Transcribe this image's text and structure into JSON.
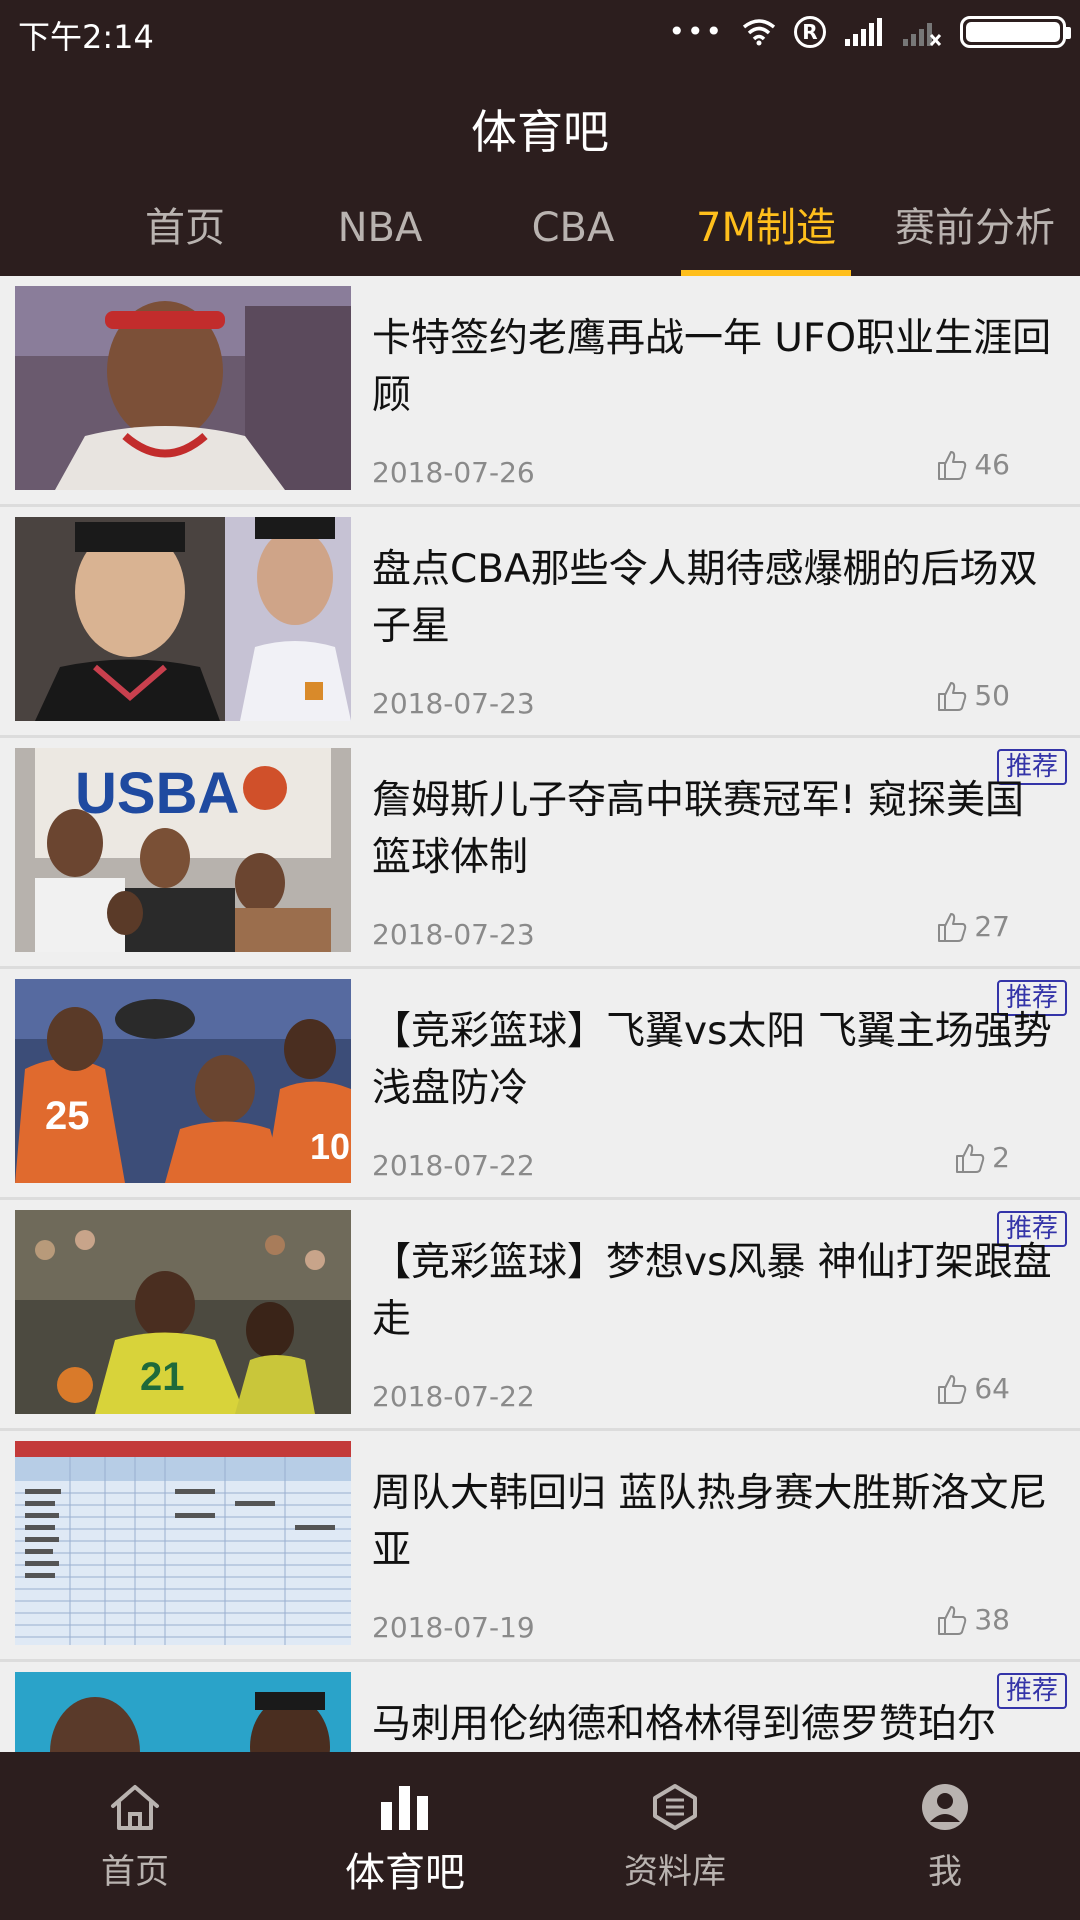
{
  "status_bar": {
    "time": "下午2:14",
    "dots": "•••"
  },
  "header": {
    "title": "体育吧"
  },
  "tabs": [
    {
      "label": "首页"
    },
    {
      "label": "NBA"
    },
    {
      "label": "CBA"
    },
    {
      "label": "7M制造"
    },
    {
      "label": "赛前分析"
    }
  ],
  "active_tab_index": 3,
  "articles": [
    {
      "title": "卡特签约老鹰再战一年 UFO职业生涯回顾",
      "date": "2018-07-26",
      "likes": "46",
      "badge": ""
    },
    {
      "title": "盘点CBA那些令人期待感爆棚的后场双子星",
      "date": "2018-07-23",
      "likes": "50",
      "badge": ""
    },
    {
      "title": "詹姆斯儿子夺高中联赛冠军! 窥探美国篮球体制",
      "date": "2018-07-23",
      "likes": "27",
      "badge": "推荐"
    },
    {
      "title": "【竞彩篮球】飞翼vs太阳 飞翼主场强势浅盘防冷",
      "date": "2018-07-22",
      "likes": "2",
      "badge": "推荐"
    },
    {
      "title": "【竞彩篮球】梦想vs风暴 神仙打架跟盘走",
      "date": "2018-07-22",
      "likes": "64",
      "badge": "推荐"
    },
    {
      "title": "周队大韩回归 蓝队热身赛大胜斯洛文尼亚",
      "date": "2018-07-19",
      "likes": "38",
      "badge": ""
    },
    {
      "title": "马刺用伦纳德和格林得到德罗赞珀尔",
      "date": "",
      "likes": "",
      "badge": "推荐"
    }
  ],
  "bottom_nav": [
    {
      "label": "首页",
      "icon": "home-icon"
    },
    {
      "label": "体育吧",
      "icon": "bar-chart-icon"
    },
    {
      "label": "资料库",
      "icon": "database-icon"
    },
    {
      "label": "我",
      "icon": "user-icon"
    }
  ],
  "colors": {
    "header_bg": "#2c1e1e",
    "accent": "#ffbf1c",
    "badge": "#3434a8",
    "page_bg": "#efefef"
  }
}
